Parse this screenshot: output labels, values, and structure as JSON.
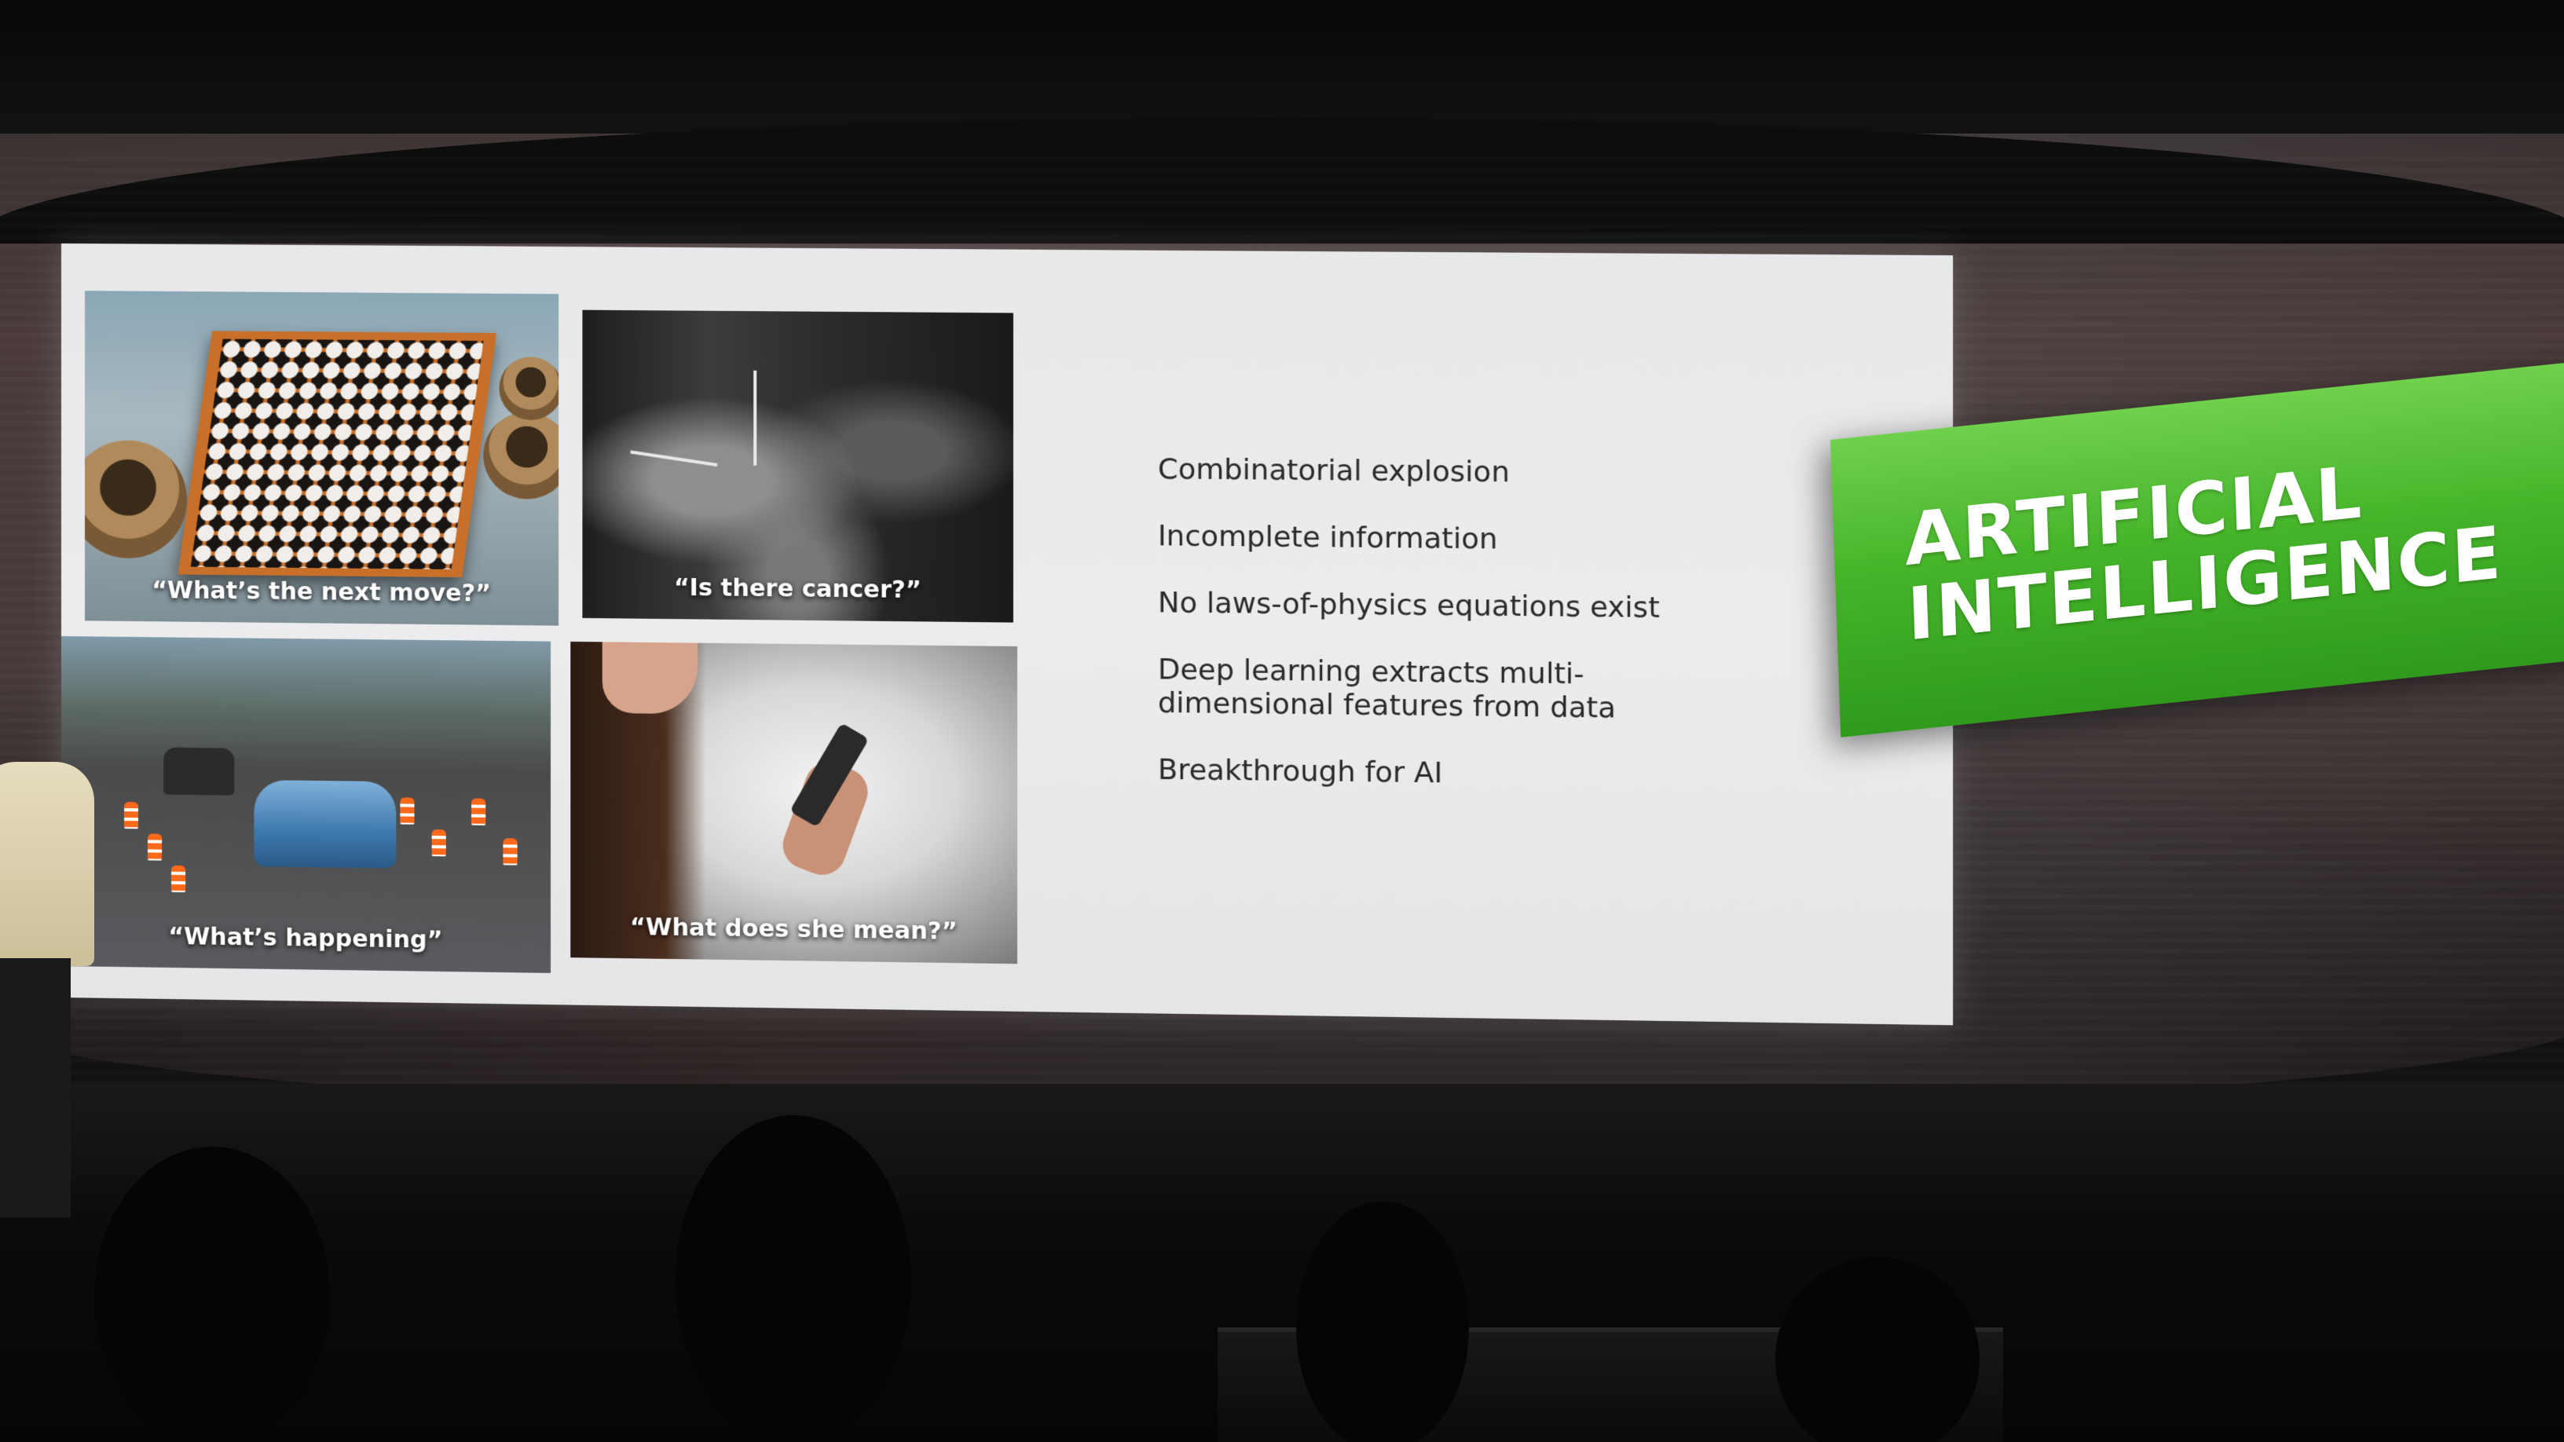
{
  "slide": {
    "tiles": [
      {
        "caption": "“What’s the next move?”",
        "icon": "go-board-icon"
      },
      {
        "caption": "“Is there cancer?”",
        "icon": "mri-scan-icon"
      },
      {
        "caption": "“What’s happening”",
        "icon": "traffic-scene-icon"
      },
      {
        "caption": "“What does she mean?”",
        "icon": "phone-user-icon"
      }
    ],
    "bullets": [
      "Combinatorial explosion",
      "Incomplete information",
      "No laws-of-physics equations exist",
      "Deep learning extracts multi-dimensional features from data",
      "Breakthrough for AI"
    ]
  },
  "banner": {
    "line1": "ARTIFICIAL",
    "line2": "INTELLIGENCE",
    "color": "#46b52a"
  }
}
